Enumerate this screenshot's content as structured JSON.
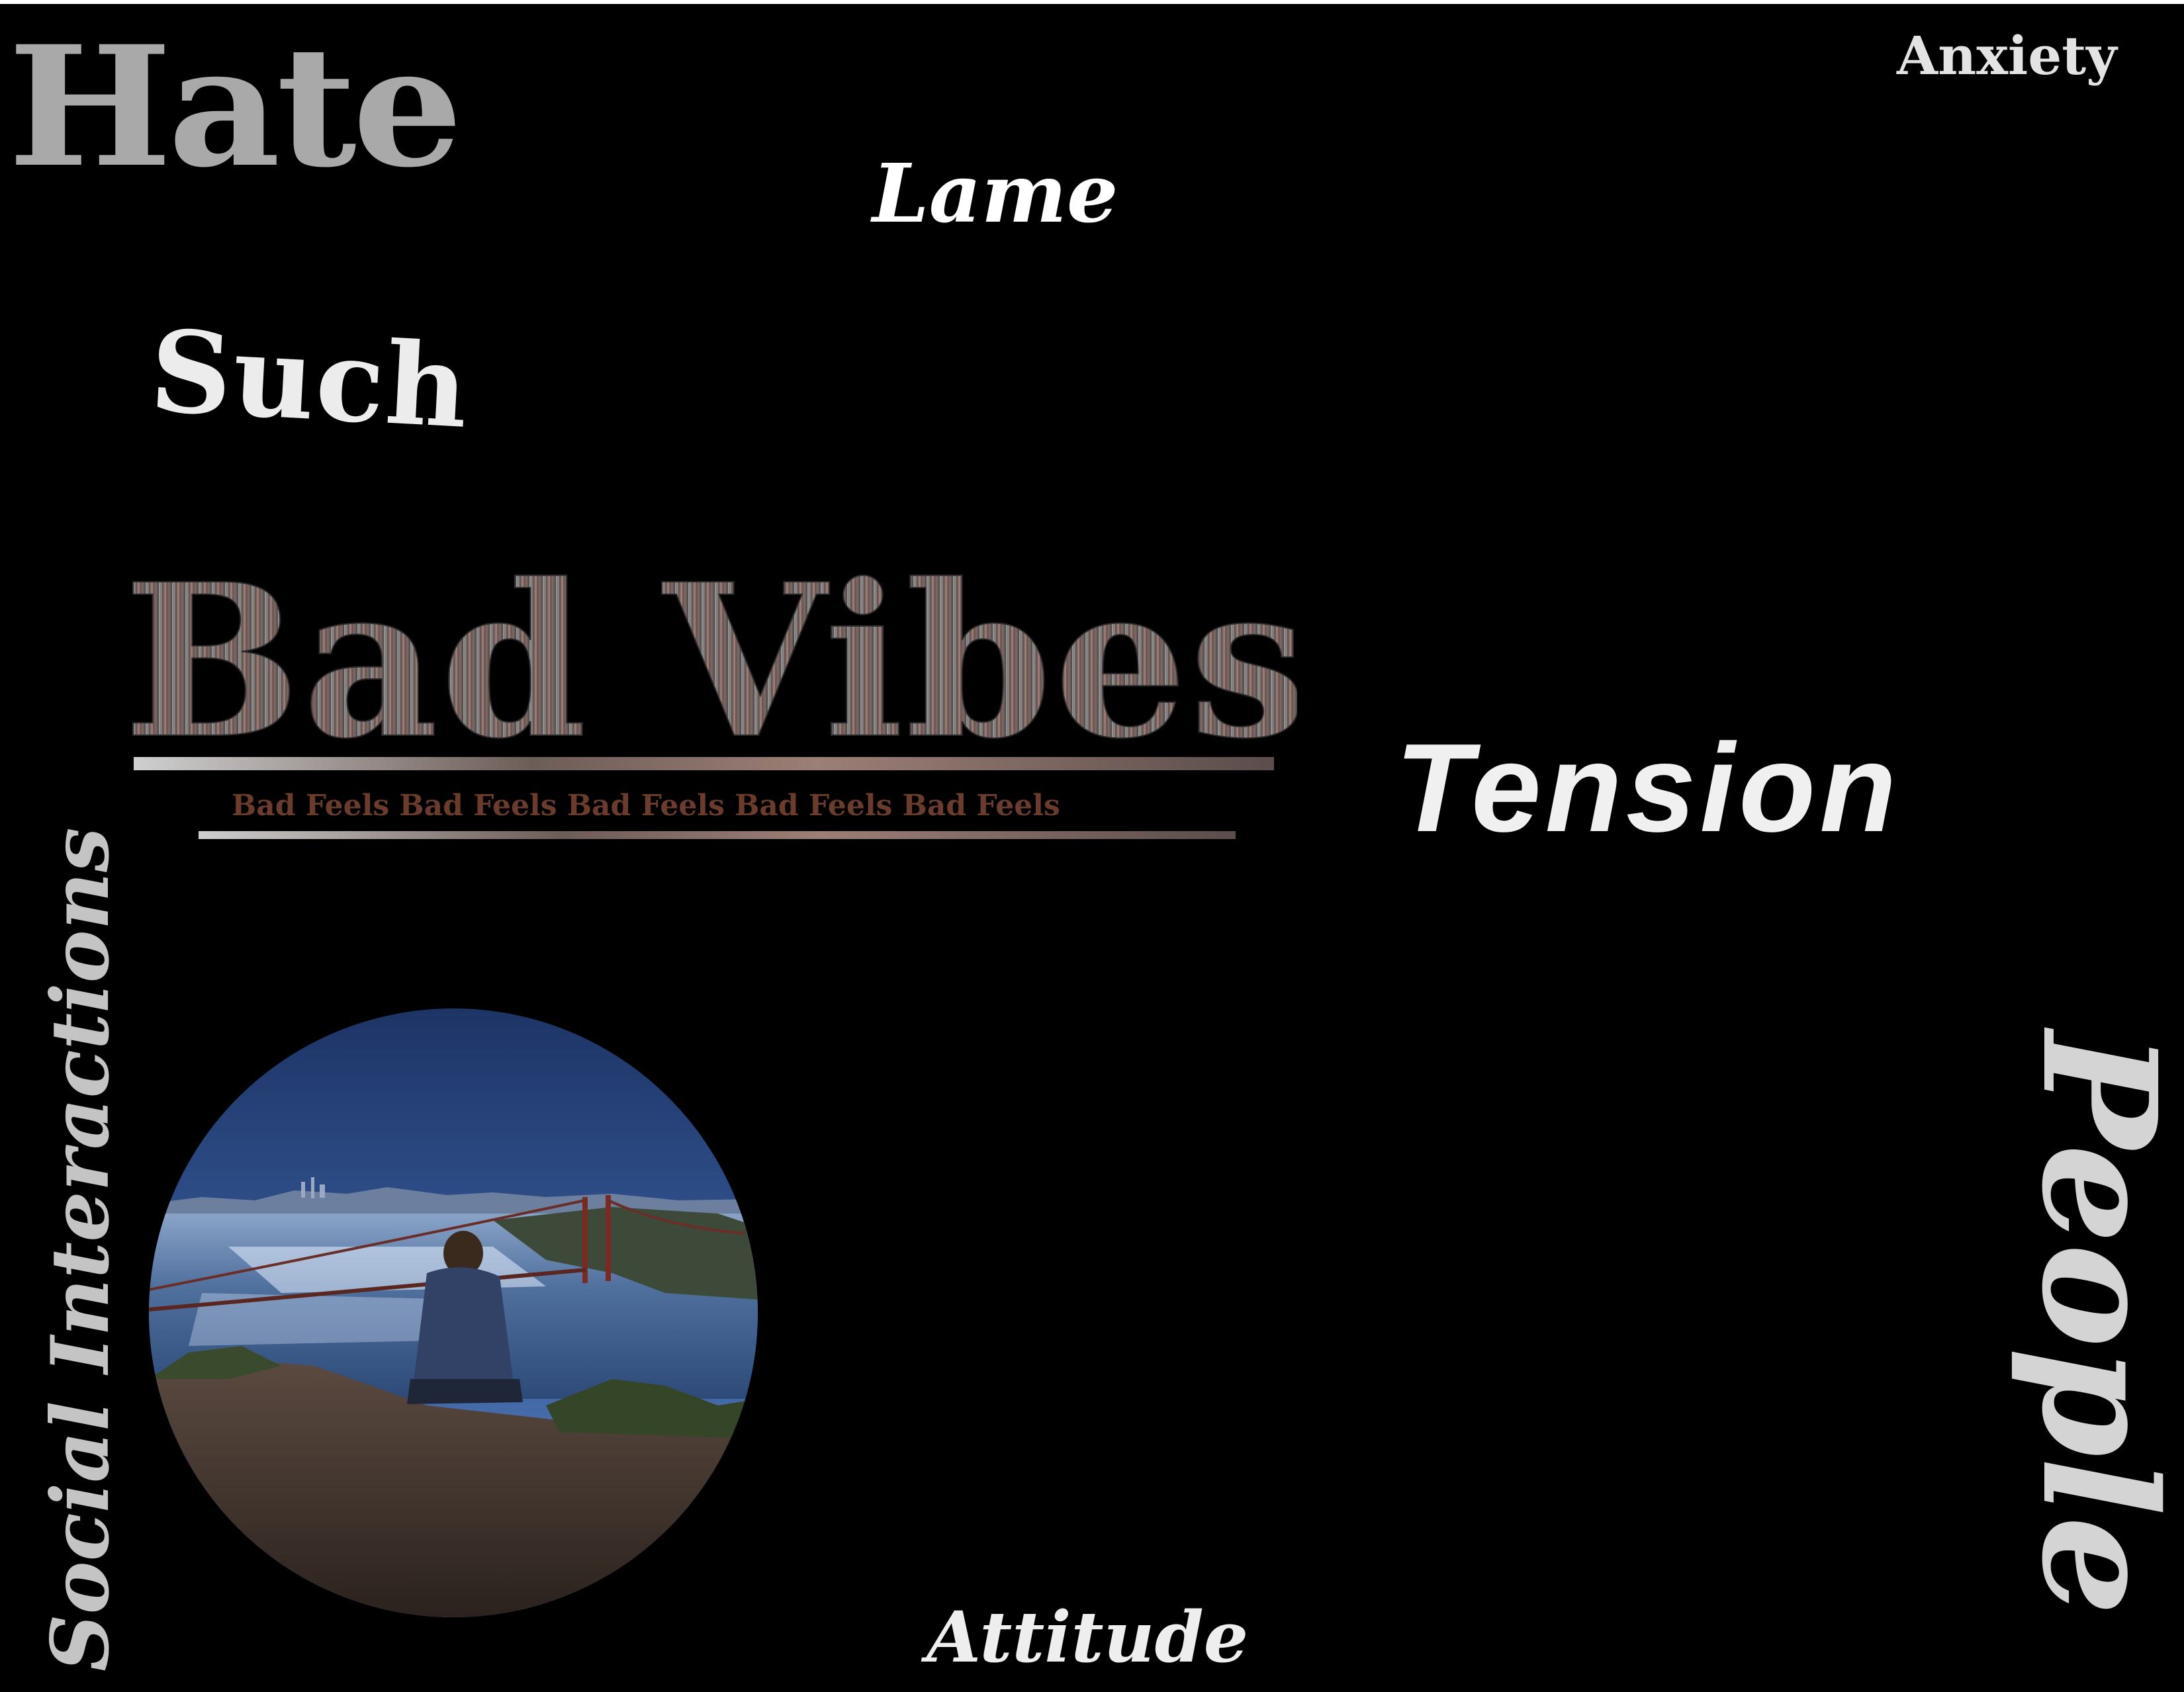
{
  "words": {
    "hate": "Hate",
    "anxiety": "Anxiety",
    "lame": "Lame",
    "such": "Such",
    "tension": "Tension",
    "attitude": "Attitude",
    "social": "Social Interactions",
    "people": "People"
  },
  "title": {
    "main": "Bad Vibes",
    "tagline": "Bad Feels Bad Feels Bad Feels Bad Feels Bad Feels"
  },
  "colors": {
    "background": "#000000",
    "tagline": "#6b3b2b"
  },
  "photo": {
    "subject": "person-sitting-overlooking-bridge-and-bay"
  }
}
